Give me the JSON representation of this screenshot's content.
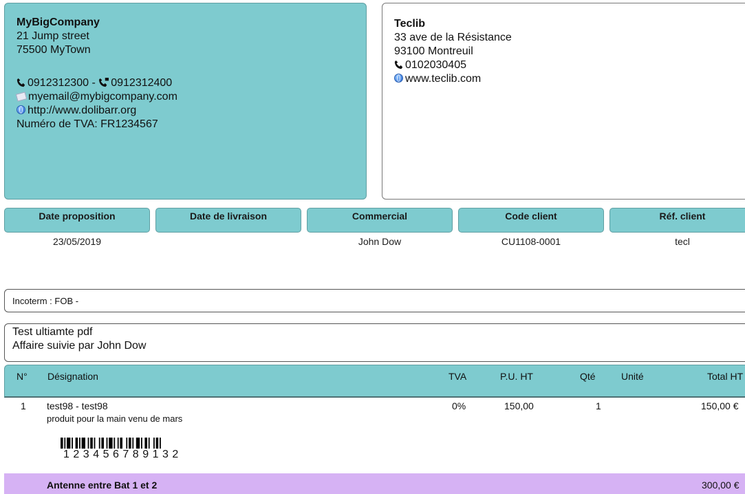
{
  "sender": {
    "name": "MyBigCompany",
    "address1": "21 Jump street",
    "address2": "75500 MyTown",
    "phone": "0912312300",
    "separator": "-",
    "fax": "0912312400",
    "email": "myemail@mybigcompany.com",
    "website": "http://www.dolibarr.org",
    "vat": "Numéro de TVA: FR1234567"
  },
  "recipient": {
    "name": "Teclib",
    "address1": "33 ave de la Résistance",
    "address2": "93100 Montreuil",
    "phone": "0102030405",
    "website": "www.teclib.com"
  },
  "info_headers": [
    {
      "label": "Date proposition",
      "value": "23/05/2019"
    },
    {
      "label": "Date de livraison",
      "value": ""
    },
    {
      "label": "Commercial",
      "value": "John Dow"
    },
    {
      "label": "Code client",
      "value": "CU1108-0001"
    },
    {
      "label": "Réf. client",
      "value": "tecl"
    }
  ],
  "incoterm": "Incoterm : FOB -",
  "note": {
    "line1": "Test ultiamte pdf",
    "line2": "Affaire suivie par John Dow"
  },
  "table": {
    "columns": {
      "num": "N°",
      "designation": "Désignation",
      "tva": "TVA",
      "pu_ht": "P.U. HT",
      "qty": "Qté",
      "unit": "Unité",
      "total": "Total HT"
    },
    "rows": [
      {
        "num": "1",
        "designation": "test98 - test98",
        "description": "produit pour la main venu de mars",
        "tva": "0%",
        "pu_ht": "150,00",
        "qty": "1",
        "unit": "",
        "total": "150,00 €",
        "barcode_digits": "123456789132"
      }
    ],
    "subtotal": {
      "label": "Antenne entre Bat 1 et 2",
      "amount": "300,00 €"
    }
  },
  "colors": {
    "header_teal": "#7ecbcf",
    "subtotal_purple": "#d6b2f4"
  }
}
